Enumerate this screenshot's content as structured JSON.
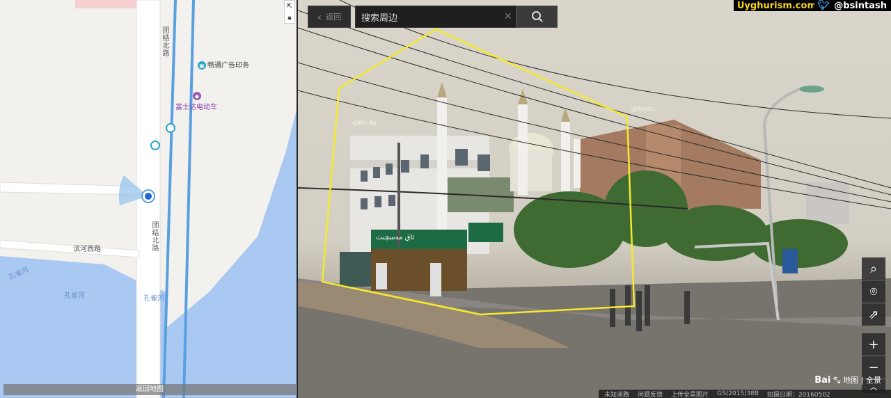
{
  "credits": {
    "site": "Uyghurism.com",
    "handle": "@bsintash",
    "twitter_icon": "bird-icon"
  },
  "map": {
    "road_labels": [
      "团结北路",
      "团结北路",
      "滨河西路"
    ],
    "water_labels": [
      "孔雀河",
      "孔雀河",
      "孔雀河"
    ],
    "pois": [
      {
        "label": "畅通广告印务",
        "icon": "shop-icon",
        "color": "#2aa6c9"
      },
      {
        "label": "富士达电动车",
        "icon": "shop-icon",
        "color": "#9b59b6"
      }
    ],
    "back_label": "返回地图",
    "colors": {
      "water": "#a9c8f2",
      "road_blue": "#5aa0e0",
      "land": "#f2f1ee"
    }
  },
  "pano": {
    "back_label": "返回",
    "search_value": "搜索周边",
    "watermark": "@Baidu",
    "brand": "Bai",
    "brand_suffix": "地图 | 全景",
    "footer": [
      "未知道路",
      "问题反馈",
      "上传全景图片",
      "GS(2015)388",
      "拍摄日期：20160502"
    ],
    "sign_text": "ئاق مەسچىت",
    "highlight_color": "#f4ea2e"
  }
}
